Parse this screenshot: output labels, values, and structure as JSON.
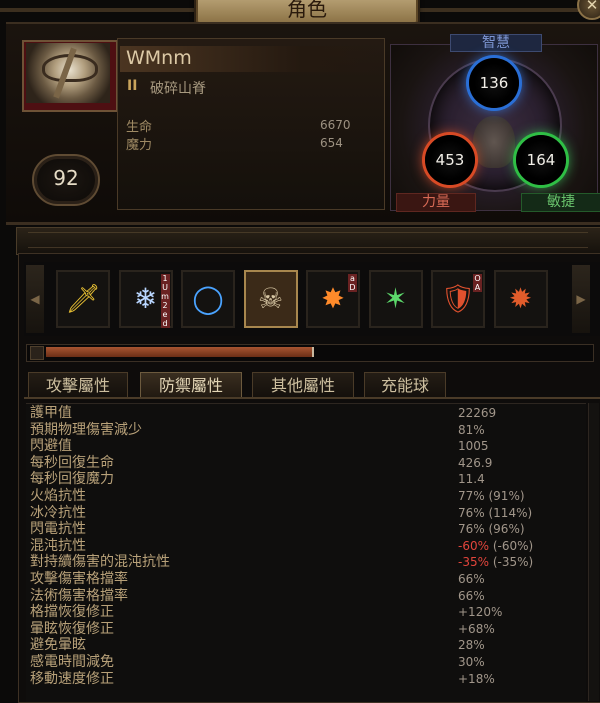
{
  "window": {
    "title": "角色",
    "close_icon": "close-icon"
  },
  "character": {
    "name": "WMnm",
    "class_rank": "II",
    "class_name": "破碎山脊",
    "level": "92",
    "life_label": "生命",
    "life_value": "6670",
    "mana_label": "魔力",
    "mana_value": "654"
  },
  "attributes": {
    "intelligence_label": "智慧",
    "intelligence": "136",
    "strength_label": "力量",
    "strength": "453",
    "dexterity_label": "敏捷",
    "dexterity": "164",
    "colors": {
      "int": "#2a6fd6",
      "str": "#d84a25",
      "dex": "#2fbf45"
    }
  },
  "skill_icons": [
    {
      "icon": "golden-sword-icon",
      "glyph": "🗡",
      "color": "#e8c033"
    },
    {
      "icon": "ice-shard-icon",
      "glyph": "❄",
      "color": "#b9d6ff",
      "badge": "1 U m 2 e d"
    },
    {
      "icon": "portal-icon",
      "glyph": "◯",
      "color": "#4aa3ff"
    },
    {
      "icon": "skull-ascendancy-icon",
      "glyph": "☠",
      "color": "#d8c7a4",
      "selected": true
    },
    {
      "icon": "fire-strike-icon",
      "glyph": "✸",
      "color": "#ff8a2a",
      "badge": "a D"
    },
    {
      "icon": "green-claw-icon",
      "glyph": "✶",
      "color": "#5cd86b"
    },
    {
      "icon": "red-shield-icon",
      "glyph": "🛡",
      "color": "#e0512e",
      "badge": "O A"
    },
    {
      "icon": "flame-burst-icon",
      "glyph": "✹",
      "color": "#e25c2b"
    }
  ],
  "progress": {
    "fraction": 0.49
  },
  "tabs": [
    {
      "label": "攻擊屬性",
      "active": false
    },
    {
      "label": "防禦屬性",
      "active": true
    },
    {
      "label": "其他屬性",
      "active": false
    },
    {
      "label": "充能球",
      "active": false
    }
  ],
  "defense_stats": [
    {
      "label": "護甲值",
      "value": "22269"
    },
    {
      "label": "預期物理傷害減少",
      "value": "81%"
    },
    {
      "label": "閃避值",
      "value": "1005"
    },
    {
      "label": "每秒回復生命",
      "value": "426.9"
    },
    {
      "label": "每秒回復魔力",
      "value": "11.4"
    },
    {
      "label": "火焰抗性",
      "value": "77%",
      "extra": " (91%)"
    },
    {
      "label": "冰冷抗性",
      "value": "76%",
      "extra": " (114%)"
    },
    {
      "label": "閃電抗性",
      "value": "76%",
      "extra": " (96%)"
    },
    {
      "label": "混沌抗性",
      "value": "-60%",
      "extra": " (-60%)",
      "negative": true
    },
    {
      "label": "對持續傷害的混沌抗性",
      "value": "-35%",
      "extra": " (-35%)",
      "negative": true
    },
    {
      "label": "攻擊傷害格擋率",
      "value": "66%"
    },
    {
      "label": "法術傷害格擋率",
      "value": "66%"
    },
    {
      "label": "格擋恢復修正",
      "value": "+120%"
    },
    {
      "label": "暈眩恢復修正",
      "value": "+68%"
    },
    {
      "label": "避免暈眩",
      "value": "28%"
    },
    {
      "label": "感電時間減免",
      "value": "30%"
    },
    {
      "label": "移動速度修正",
      "value": "+18%"
    }
  ]
}
